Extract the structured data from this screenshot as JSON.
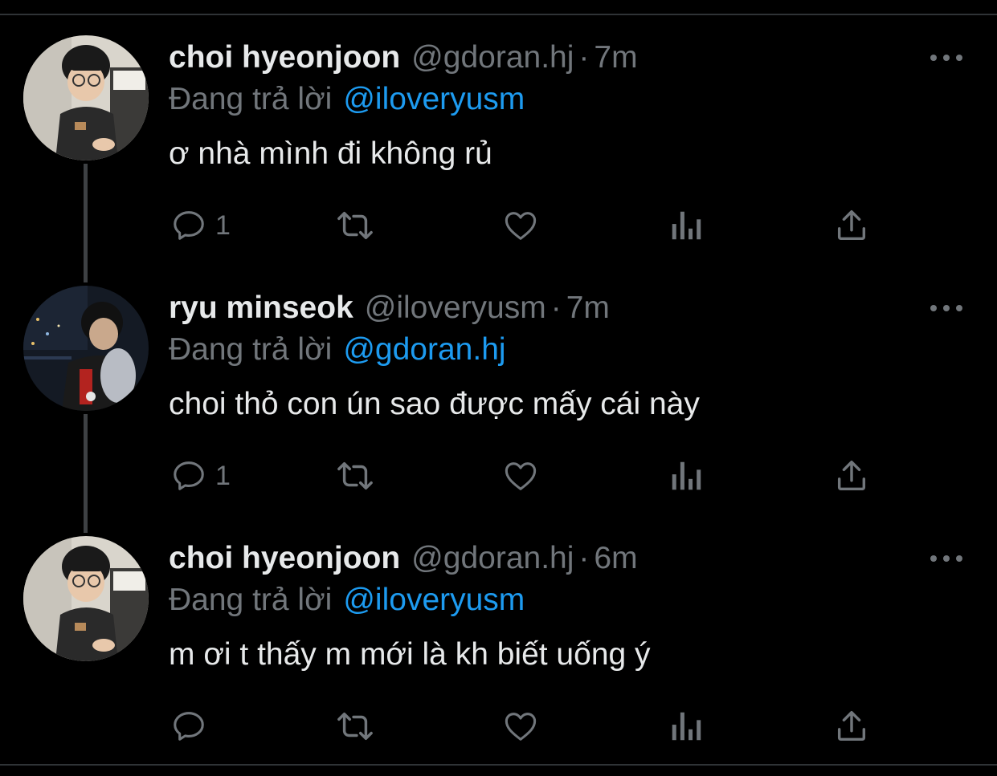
{
  "tweets": [
    {
      "display_name": "choi hyeonjoon",
      "handle": "@gdoran.hj",
      "separator": "·",
      "time": "7m",
      "reply_prefix": "Đang trả lời",
      "reply_to": "@iloveryusm",
      "text": "ơ nhà mình đi không rủ",
      "reply_count": "1",
      "avatar": "person-avatar-glasses"
    },
    {
      "display_name": "ryu minseok",
      "handle": "@iloveryusm",
      "separator": "·",
      "time": "7m",
      "reply_prefix": "Đang trả lời",
      "reply_to": "@gdoran.hj",
      "text": "choi thỏ con ún sao được mấy cái này",
      "reply_count": "1",
      "avatar": "person-avatar-city-night"
    },
    {
      "display_name": "choi hyeonjoon",
      "handle": "@gdoran.hj",
      "separator": "·",
      "time": "6m",
      "reply_prefix": "Đang trả lời",
      "reply_to": "@iloveryusm",
      "text": "m ơi t thấy m mới là kh biết uống ý",
      "reply_count": "",
      "avatar": "person-avatar-glasses"
    }
  ],
  "icons": {
    "reply": "reply-bubble-icon",
    "retweet": "retweet-icon",
    "like": "heart-icon",
    "views": "views-bar-chart-icon",
    "share": "share-upload-icon",
    "more": "more-dots-icon"
  },
  "colors": {
    "background": "#000000",
    "text_primary": "#e7e9ea",
    "text_secondary": "#71767b",
    "mention": "#1d9bf0",
    "divider": "#2f3336",
    "thread_line": "#3e4144"
  }
}
